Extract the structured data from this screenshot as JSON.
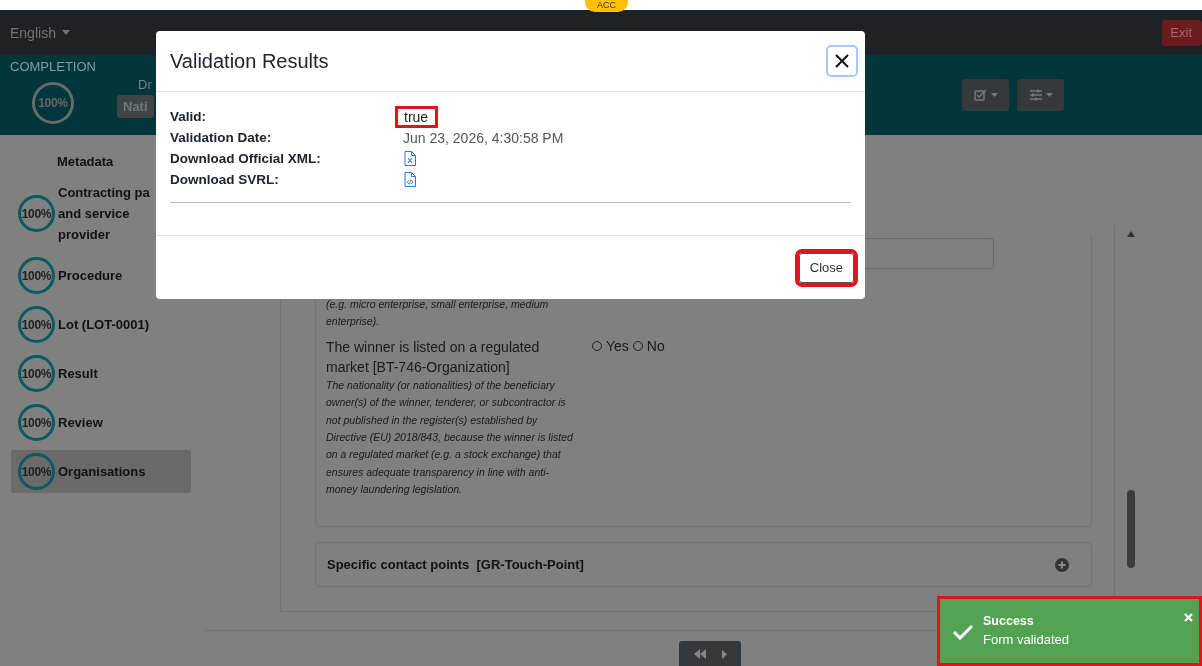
{
  "environment_badge": "ACC",
  "navbar": {
    "language": "English",
    "exit_button": "Exit"
  },
  "header": {
    "completion_label": "COMPLETION",
    "completion": "100%",
    "status_text": "Dr",
    "notice_type": "Nati"
  },
  "sidebar": {
    "items": [
      {
        "label": "Metadata",
        "selected": false
      },
      {
        "label": "Contracting pa and service provider",
        "progress": "100%",
        "selected": false
      },
      {
        "label": "Procedure",
        "progress": "100%",
        "selected": false
      },
      {
        "label": "Lot (LOT-0001)",
        "progress": "100%",
        "selected": false
      },
      {
        "label": "Result",
        "progress": "100%",
        "selected": false
      },
      {
        "label": "Review",
        "progress": "100%",
        "selected": false
      },
      {
        "label": "Organisations",
        "progress": "100%",
        "selected": true
      }
    ]
  },
  "form": {
    "partial_hint": "(e.g. micro enterprise, small enterprise, medium enterprise).",
    "question": {
      "label": "The winner is listed on a regulated market [BT-746-Organization]",
      "hint": "The nationality (or nationalities) of the beneficiary owner(s) of the winner, tenderer, or subcontractor is not published in the register(s) established by Directive (EU) 2018/843, because the winner is listed on a regulated market (e.g. a stock exchange) that ensures adequate transparency in line with anti-money laundering legislation.",
      "options": [
        {
          "label": "Yes",
          "selected": false
        },
        {
          "label": "No",
          "selected": false
        }
      ]
    },
    "section": {
      "title": "Specific contact points  [GR-Touch-Point]",
      "expanded": false
    }
  },
  "modal": {
    "title": "Validation Results",
    "rows": [
      {
        "label": "Valid:",
        "kind": "text",
        "value": "true",
        "highlighted": true
      },
      {
        "label": "Validation Date:",
        "kind": "text",
        "value": "Jun 23, 2026, 4:30:58 PM",
        "highlighted": false
      },
      {
        "label": "Download Official XML:",
        "kind": "xml-file",
        "highlighted": false
      },
      {
        "label": "Download SVRL:",
        "kind": "code-file",
        "highlighted": false
      }
    ],
    "close_button": {
      "label": "Close",
      "highlighted": true
    }
  },
  "toast": {
    "title": "Success",
    "message": "Form validated",
    "highlighted": true
  }
}
